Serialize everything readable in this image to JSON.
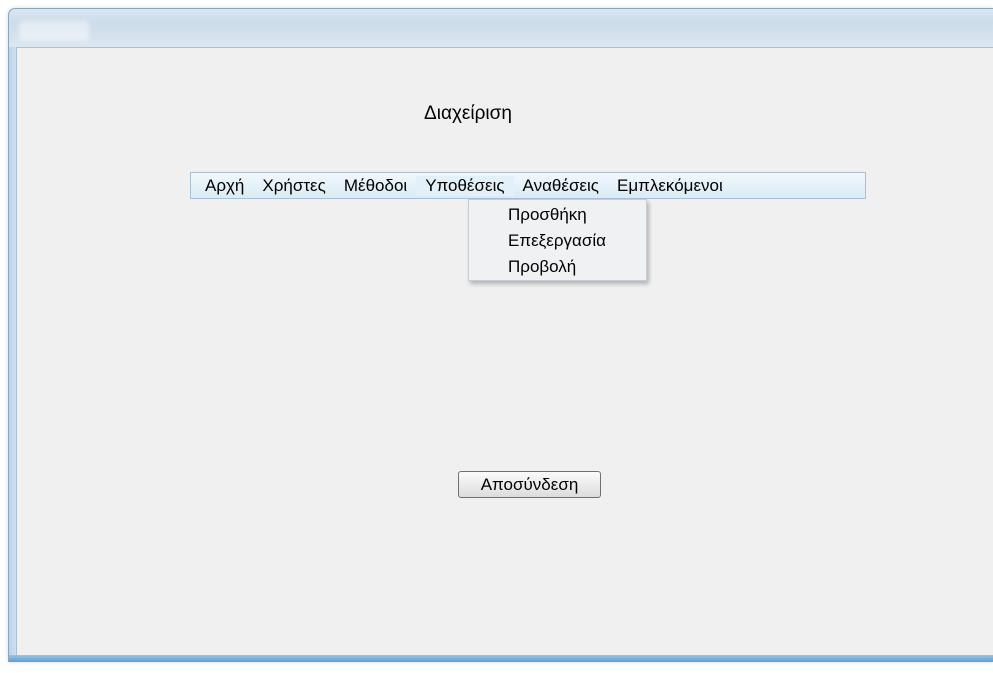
{
  "page": {
    "title": "Διαχείριση"
  },
  "menu": {
    "items": [
      {
        "label": "Αρχή"
      },
      {
        "label": "Χρήστες"
      },
      {
        "label": "Μέθοδοι"
      },
      {
        "label": "Υποθέσεις"
      },
      {
        "label": "Αναθέσεις"
      },
      {
        "label": "Εμπλεκόμενοι"
      }
    ],
    "open_submenu": {
      "parent": "Υποθέσεις",
      "items": [
        {
          "label": "Προσθήκη"
        },
        {
          "label": "Επεξεργασία"
        },
        {
          "label": "Προβολή"
        }
      ]
    }
  },
  "actions": {
    "logout_label": "Αποσύνδεση"
  }
}
